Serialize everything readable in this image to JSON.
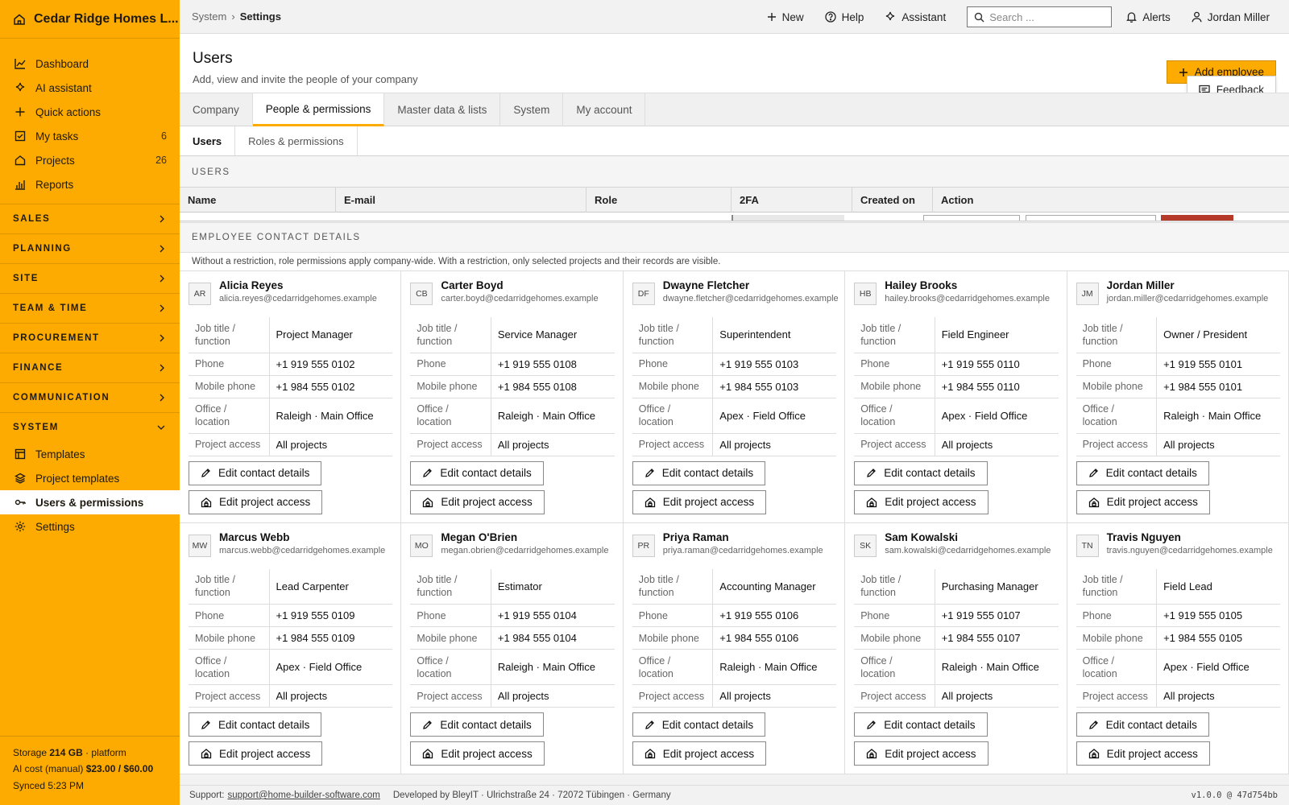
{
  "app": {
    "name": "Cedar Ridge Homes L..."
  },
  "sidebar": {
    "top_items": [
      {
        "label": "Dashboard",
        "icon": "chart-icon",
        "count": ""
      },
      {
        "label": "AI assistant",
        "icon": "sparkle-icon",
        "count": ""
      },
      {
        "label": "Quick actions",
        "icon": "plus-icon",
        "count": ""
      },
      {
        "label": "My tasks",
        "icon": "checkbox-icon",
        "count": "6"
      },
      {
        "label": "Projects",
        "icon": "home-icon",
        "count": "26"
      },
      {
        "label": "Reports",
        "icon": "bar-chart-icon",
        "count": ""
      }
    ],
    "sections": [
      {
        "label": "SALES"
      },
      {
        "label": "PLANNING"
      },
      {
        "label": "SITE"
      },
      {
        "label": "TEAM & TIME"
      },
      {
        "label": "PROCUREMENT"
      },
      {
        "label": "FINANCE"
      },
      {
        "label": "COMMUNICATION"
      },
      {
        "label": "SYSTEM"
      }
    ],
    "system_items": [
      {
        "label": "Templates",
        "icon": "template-icon"
      },
      {
        "label": "Project templates",
        "icon": "layers-icon"
      },
      {
        "label": "Users & permissions",
        "icon": "key-icon"
      },
      {
        "label": "Settings",
        "icon": "gear-icon"
      }
    ],
    "footer": {
      "storage_prefix": "Storage ",
      "storage_value": "214 GB",
      "storage_suffix": " · platform",
      "ai_prefix": "AI cost (manual) ",
      "ai_value": "$23.00 / $60.00",
      "synced": "Synced 5:23 PM"
    }
  },
  "topbar": {
    "breadcrumb_root": "System",
    "breadcrumb_sep": "›",
    "breadcrumb_current": "Settings",
    "new_label": "New",
    "help_label": "Help",
    "assistant_label": "Assistant",
    "search_placeholder": "Search ...",
    "alerts_label": "Alerts",
    "user_label": "Jordan Miller"
  },
  "page": {
    "title": "Users",
    "subtitle": "Add, view and invite the people of your company",
    "add_button": "Add employee",
    "feedback_button": "Feedback"
  },
  "tabs": [
    "Company",
    "People & permissions",
    "Master data & lists",
    "System",
    "My account"
  ],
  "subtabs": [
    "Users",
    "Roles & permissions"
  ],
  "users_section": {
    "label": "USERS",
    "columns": [
      "Name",
      "E-mail",
      "Role",
      "2FA",
      "Created on",
      "Action"
    ]
  },
  "contacts_section": {
    "label": "EMPLOYEE CONTACT DETAILS",
    "hint": "Without a restriction, role permissions apply company-wide. With a restriction, only selected projects and their records are visible.",
    "field_labels": {
      "job": "Job title / function",
      "phone": "Phone",
      "mobile": "Mobile phone",
      "office": "Office / location",
      "access": "Project access"
    },
    "edit_contact_label": "Edit contact details",
    "edit_access_label": "Edit project access"
  },
  "employees": [
    {
      "initials": "AR",
      "name": "Alicia Reyes",
      "email": "alicia.reyes@cedarridgehomes.example",
      "job": "Project Manager",
      "phone": "+1 919 555 0102",
      "mobile": "+1 984 555 0102",
      "office": "Raleigh · Main Office",
      "access": "All projects"
    },
    {
      "initials": "CB",
      "name": "Carter Boyd",
      "email": "carter.boyd@cedarridgehomes.example",
      "job": "Service Manager",
      "phone": "+1 919 555 0108",
      "mobile": "+1 984 555 0108",
      "office": "Raleigh · Main Office",
      "access": "All projects"
    },
    {
      "initials": "DF",
      "name": "Dwayne Fletcher",
      "email": "dwayne.fletcher@cedarridgehomes.example",
      "job": "Superintendent",
      "phone": "+1 919 555 0103",
      "mobile": "+1 984 555 0103",
      "office": "Apex · Field Office",
      "access": "All projects"
    },
    {
      "initials": "HB",
      "name": "Hailey Brooks",
      "email": "hailey.brooks@cedarridgehomes.example",
      "job": "Field Engineer",
      "phone": "+1 919 555 0110",
      "mobile": "+1 984 555 0110",
      "office": "Apex · Field Office",
      "access": "All projects"
    },
    {
      "initials": "JM",
      "name": "Jordan Miller",
      "email": "jordan.miller@cedarridgehomes.example",
      "job": "Owner / President",
      "phone": "+1 919 555 0101",
      "mobile": "+1 984 555 0101",
      "office": "Raleigh · Main Office",
      "access": "All projects"
    },
    {
      "initials": "MW",
      "name": "Marcus Webb",
      "email": "marcus.webb@cedarridgehomes.example",
      "job": "Lead Carpenter",
      "phone": "+1 919 555 0109",
      "mobile": "+1 984 555 0109",
      "office": "Apex · Field Office",
      "access": "All projects"
    },
    {
      "initials": "MO",
      "name": "Megan O'Brien",
      "email": "megan.obrien@cedarridgehomes.example",
      "job": "Estimator",
      "phone": "+1 919 555 0104",
      "mobile": "+1 984 555 0104",
      "office": "Raleigh · Main Office",
      "access": "All projects"
    },
    {
      "initials": "PR",
      "name": "Priya Raman",
      "email": "priya.raman@cedarridgehomes.example",
      "job": "Accounting Manager",
      "phone": "+1 919 555 0106",
      "mobile": "+1 984 555 0106",
      "office": "Raleigh · Main Office",
      "access": "All projects"
    },
    {
      "initials": "SK",
      "name": "Sam Kowalski",
      "email": "sam.kowalski@cedarridgehomes.example",
      "job": "Purchasing Manager",
      "phone": "+1 919 555 0107",
      "mobile": "+1 984 555 0107",
      "office": "Raleigh · Main Office",
      "access": "All projects"
    },
    {
      "initials": "TN",
      "name": "Travis Nguyen",
      "email": "travis.nguyen@cedarridgehomes.example",
      "job": "Field Lead",
      "phone": "+1 919 555 0105",
      "mobile": "+1 984 555 0105",
      "office": "Apex · Field Office",
      "access": "All projects"
    }
  ],
  "footer": {
    "support_prefix": "Support:",
    "support_email": "support@home-builder-software.com",
    "developer": "Developed by BleyIT · Ulrichstraße 24 · 72072 Tübingen · Germany",
    "version": "v1.0.0 @ 47d754bb"
  }
}
